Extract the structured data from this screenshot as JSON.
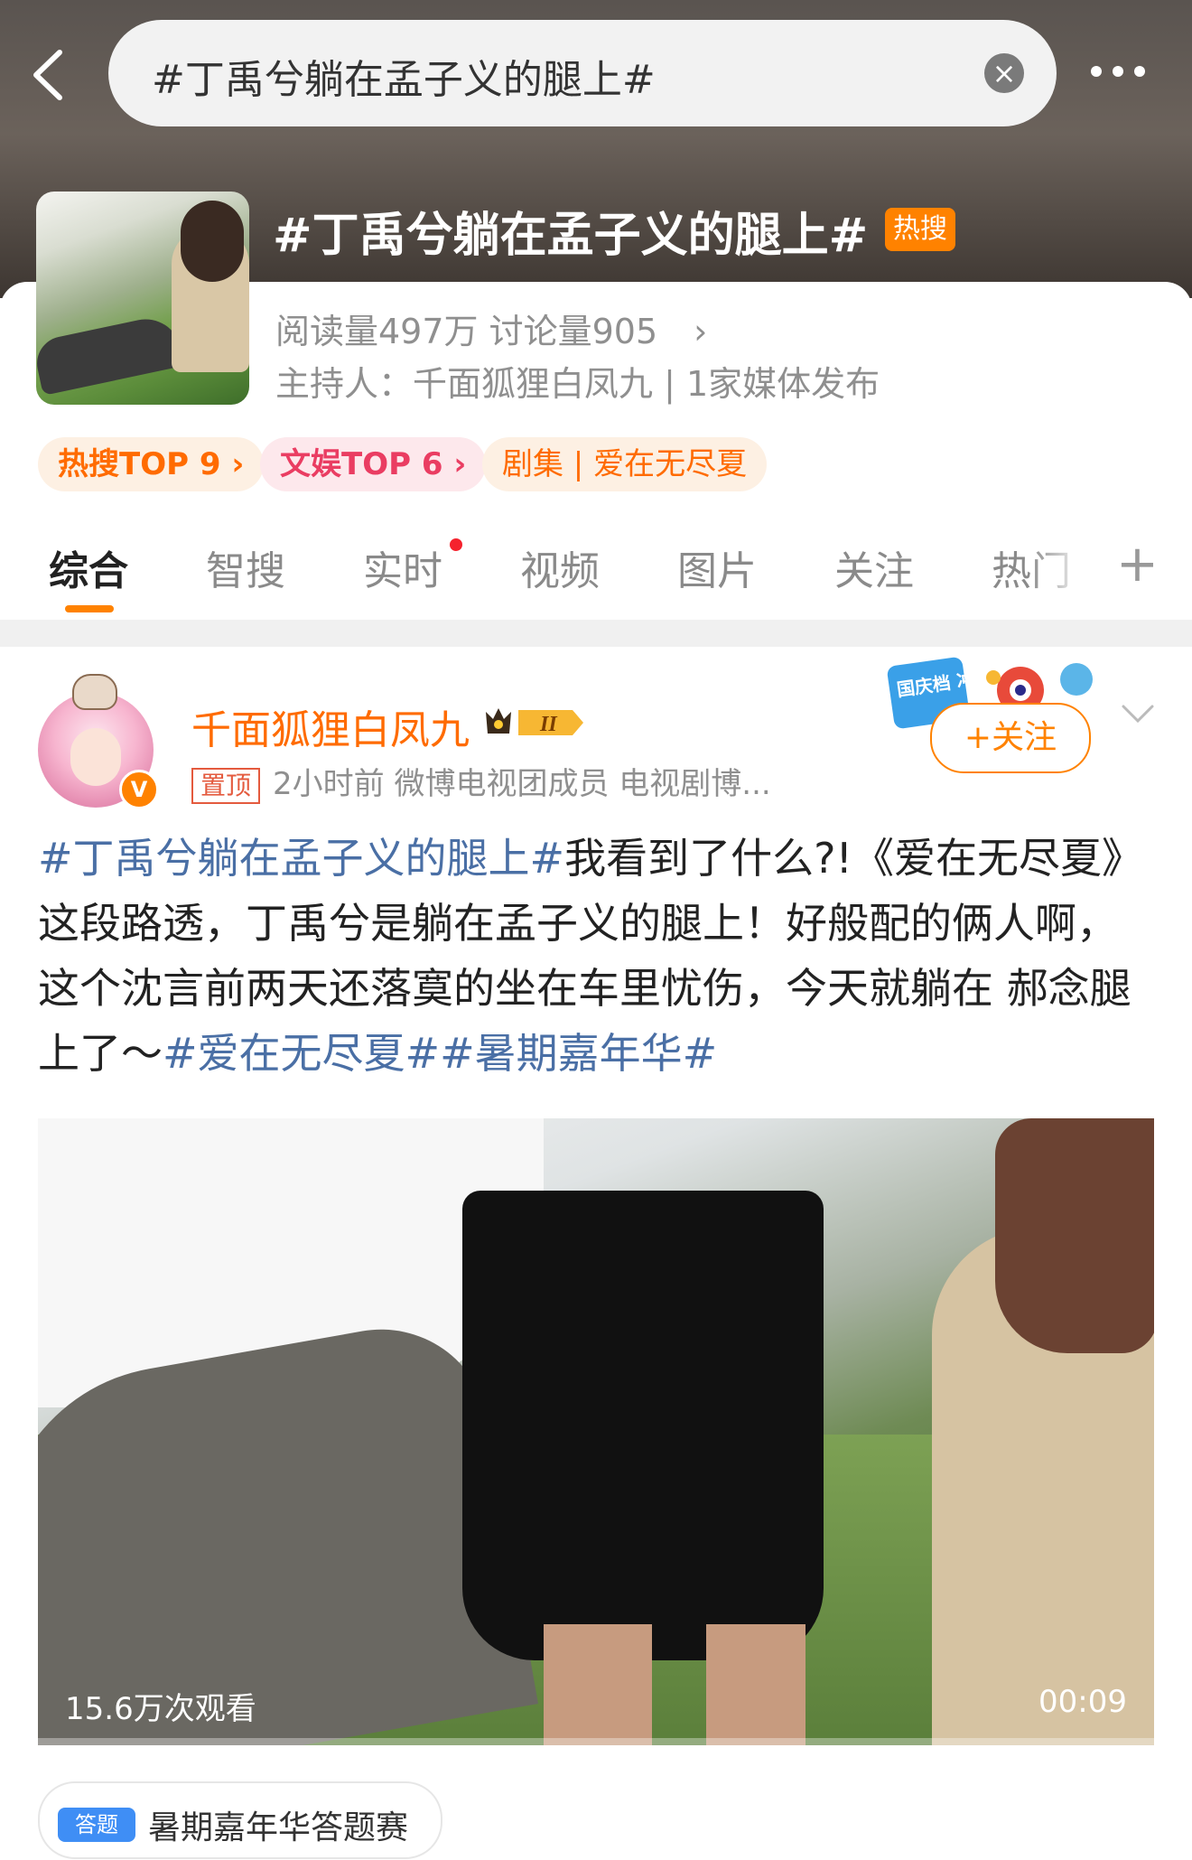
{
  "header": {
    "search_query": "#丁禹兮躺在孟子义的腿上#",
    "back_icon": "chevron-left-icon",
    "clear_icon": "close-circle-icon",
    "more_icon": "more-horizontal-icon"
  },
  "topic": {
    "title": "#丁禹兮躺在孟子义的腿上#",
    "badge": "热搜",
    "stats": "阅读量497万  讨论量905",
    "stats_chevron": "›",
    "host": "主持人：千面狐狸白凤九 | 1家媒体发布",
    "chips": [
      "热搜TOP 9 ›",
      "文娱TOP 6 ›",
      "剧集 | 爱在无尽夏"
    ]
  },
  "tabs": {
    "items": [
      "综合",
      "智搜",
      "实时",
      "视频",
      "图片",
      "关注",
      "热门"
    ],
    "active": "综合",
    "plus": "+"
  },
  "post": {
    "username": "千面狐狸白凤九",
    "level_badge": "II",
    "pin_label": "置顶",
    "meta": "2小时前  微博电视团成员 电视剧博...",
    "follow_label": "+关注",
    "event_badge": "国庆档 冲浪大",
    "text_link1": "#丁禹兮躺在孟子义的腿上#",
    "text_body": "我看到了什么?!《爱在无尽夏》这段路透，丁禹兮是躺在孟子义的腿上！好般配的俩人啊，这个沈言前两天还落寞的坐在车里忧伤，今天就躺在 郝念腿上了～",
    "text_link2": "#爱在无尽夏##暑期嘉年华#",
    "video_views": "15.6万次观看",
    "video_duration": "00:09"
  },
  "bottom_tag": {
    "icon_label": "答题",
    "text": "暑期嘉年华答题赛"
  },
  "colors": {
    "accent": "#ff8200",
    "link": "#4a6fa5",
    "hot_chip_text": "#ff6b00",
    "ent_chip_text": "#ea3d62"
  }
}
